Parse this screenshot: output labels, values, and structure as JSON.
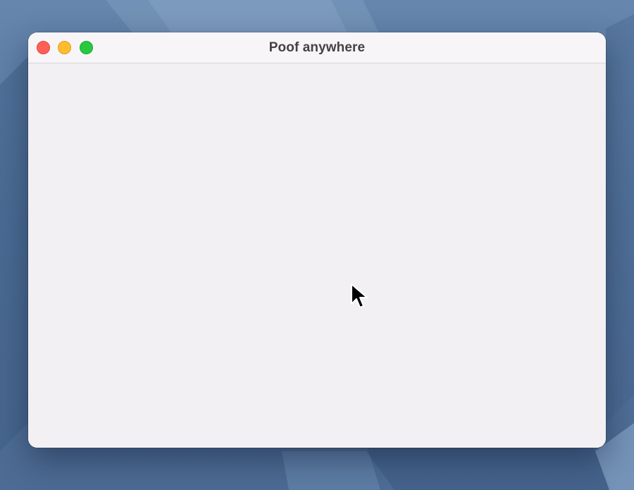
{
  "window": {
    "title": "Poof anywhere",
    "controls": {
      "close_icon": "close-icon",
      "minimize_icon": "minimize-icon",
      "zoom_icon": "zoom-icon"
    }
  },
  "colors": {
    "close": "#fe5f57",
    "minimize": "#febc2e",
    "zoom": "#28c840",
    "window_background": "#f2f0f3",
    "desktop": "#5f80a8"
  },
  "pointer": {
    "icon": "arrow-cursor-icon"
  }
}
